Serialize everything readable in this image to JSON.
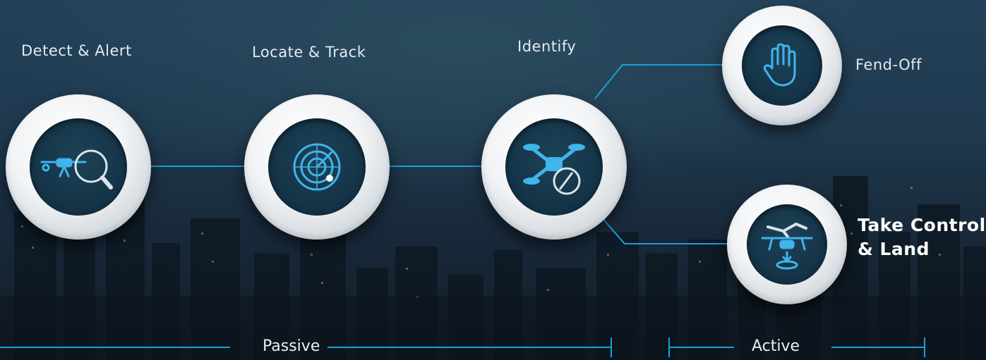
{
  "stages": [
    {
      "id": "detect",
      "label": "Detect &  Alert"
    },
    {
      "id": "locate",
      "label": "Locate & Track"
    },
    {
      "id": "identify",
      "label": "Identify"
    },
    {
      "id": "fendoff",
      "label": "Fend-Off"
    },
    {
      "id": "takecontrol",
      "label": "Take Control\n& Land"
    }
  ],
  "phases": {
    "passive": "Passive",
    "active": "Active"
  },
  "colors": {
    "accent": "#1d9fd8",
    "icon": "#3fb5ea",
    "ring": "#f1f3f5",
    "inner": "#143246"
  },
  "icons": {
    "detect": "drone-magnifier-icon",
    "locate": "radar-icon",
    "identify": "drone-scan-icon",
    "fendoff": "hand-stop-icon",
    "takecontrol": "drone-landing-icon"
  }
}
